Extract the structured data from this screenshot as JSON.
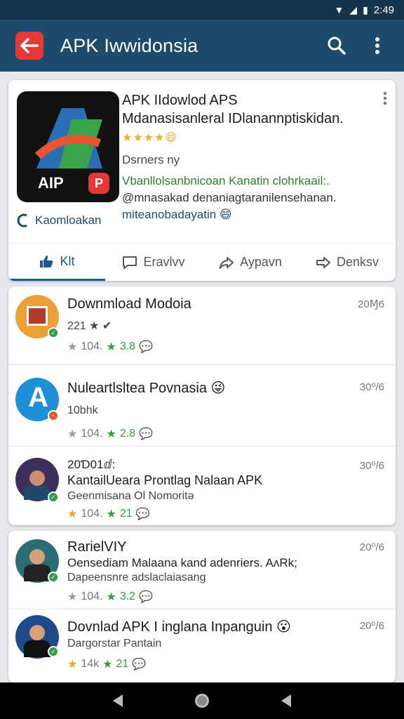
{
  "statusbar": {
    "time": "2:49",
    "icons": [
      "wifi-icon",
      "signal-icon",
      "battery-icon"
    ]
  },
  "appbar": {
    "title": "APK Iwwidonsia",
    "back_icon": "back-arrow-icon",
    "search_icon": "search-icon",
    "more_icon": "more-vert-icon"
  },
  "hero": {
    "logo_text": "AIP",
    "logo_badge": "P",
    "brand": "Kaomloakan",
    "title": "APK IIdowlod APS",
    "subtitle": "Mdanasisanleral IDlanannptiskidan.",
    "rating": "★★★★",
    "rating_emoji": "😄",
    "developer": "Dsrners ny",
    "desc1": "Vbanllolsanbnicoan Kanatin clohrkaail:.",
    "desc2": "@mnasakad denaniagtaranilensehanan.",
    "desc3": "miteanobadayatin 😄"
  },
  "tabs": [
    {
      "label": "Klt",
      "icon": "thumbs-up-icon"
    },
    {
      "label": "Eravlvv",
      "icon": "comment-icon"
    },
    {
      "label": "Aypavn",
      "icon": "share-icon"
    },
    {
      "label": "Denksv",
      "icon": "forward-icon"
    }
  ],
  "list1": [
    {
      "title": "Downmload Modoia",
      "line1": "221 ★ ✔",
      "line2": "",
      "time": "20Ɱ6",
      "stat_a": "104.",
      "stat_b": "3.8"
    },
    {
      "title": "Nuleartlsltea Povnasia 😜",
      "line1": "10bhk",
      "line2": "",
      "time": "30⁰/6",
      "stat_a": "104.",
      "stat_b": "2.8"
    },
    {
      "title": "KantailUeara Prontlag Nalaan APK",
      "line1": "20Ɗ01ⅆ:",
      "line2": "Geenmisana Ol Nomoritə",
      "time": "30⁰/6",
      "stat_a": "104.",
      "stat_b": "21"
    }
  ],
  "list2": [
    {
      "title": "RarielVIY",
      "line1": "Oensediam Malaana kand adenriers. AʌRk;",
      "line2": "Dapeensnre adslaclaiasang",
      "time": "20⁰/6",
      "stat_a": "104.",
      "stat_b": "3.2"
    },
    {
      "title": "Dovnlad APK I inglana Inpanguin 😮",
      "line1": "Dargorstar Pantain",
      "line2": "",
      "time": "20⁰/6",
      "stat_a": "14k",
      "stat_b": "21"
    }
  ],
  "nav": {
    "back": "nav-back-icon",
    "home": "nav-home-icon",
    "recent": "nav-recent-icon"
  }
}
